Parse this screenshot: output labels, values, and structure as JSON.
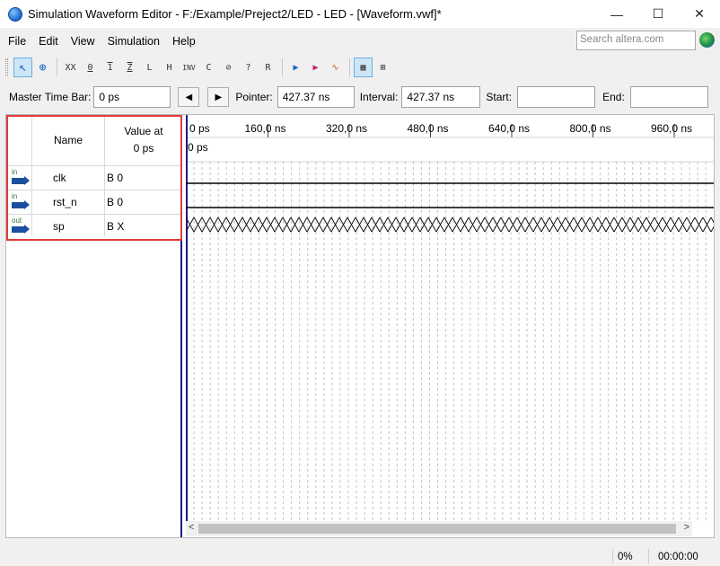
{
  "window": {
    "title": "Simulation Waveform Editor - F:/Example/Preject2/LED - LED - [Waveform.vwf]*",
    "minimize": "—",
    "maximize": "☐",
    "close": "✕"
  },
  "menu": {
    "items": [
      "File",
      "Edit",
      "View",
      "Simulation",
      "Help"
    ],
    "search_placeholder": "Search altera.com"
  },
  "toolbar": {
    "buttons": [
      {
        "icon": "pointer-icon",
        "glyph": "↖",
        "active": true
      },
      {
        "icon": "zoom-icon",
        "glyph": "🔍"
      },
      {
        "icon": "forcing-unknown-icon",
        "glyph": "XX"
      },
      {
        "icon": "forcing-low-icon",
        "glyph": "0"
      },
      {
        "icon": "forcing-high-icon",
        "glyph": "1"
      },
      {
        "icon": "forcing-z-icon",
        "glyph": "Z"
      },
      {
        "icon": "weak-low-icon",
        "glyph": "L"
      },
      {
        "icon": "weak-high-icon",
        "glyph": "H"
      },
      {
        "icon": "invert-icon",
        "glyph": "INV"
      },
      {
        "icon": "count-value-icon",
        "glyph": "C"
      },
      {
        "icon": "overwrite-clock-icon",
        "glyph": "⊘"
      },
      {
        "icon": "arbitrary-value-icon",
        "glyph": "?"
      },
      {
        "icon": "random-value-icon",
        "glyph": "R"
      },
      {
        "icon": "run-functional-sim-icon",
        "glyph": "▶"
      },
      {
        "icon": "run-timing-sim-icon",
        "glyph": "▶"
      },
      {
        "icon": "generate-netlist-icon",
        "glyph": "∿"
      },
      {
        "icon": "waveform-compare-icon",
        "glyph": "▦",
        "active": true
      },
      {
        "icon": "snap-grid-icon",
        "glyph": "⊞"
      }
    ]
  },
  "timebar": {
    "master_label": "Master Time Bar:",
    "master_value": "0 ps",
    "prev": "◀",
    "next": "▶",
    "pointer_label": "Pointer:",
    "pointer_value": "427.37 ns",
    "interval_label": "Interval:",
    "interval_value": "427.37 ns",
    "start_label": "Start:",
    "start_value": "",
    "end_label": "End:",
    "end_value": ""
  },
  "signal_table": {
    "col_name": "Name",
    "col_value_line1": "Value at",
    "col_value_line2": "0 ps",
    "signals": [
      {
        "dir": "in",
        "name": "clk",
        "value": "B 0",
        "wave": "low"
      },
      {
        "dir": "in",
        "name": "rst_n",
        "value": "B 0",
        "wave": "low"
      },
      {
        "dir": "out",
        "name": "sp",
        "value": "B X",
        "wave": "unknown"
      }
    ]
  },
  "timeline": {
    "ticks": [
      "0 ps",
      "160,0 ns",
      "320,0 ns",
      "480,0 ns",
      "640,0 ns",
      "800,0 ns",
      "960,0 ns"
    ],
    "cursor_label": "0 ps"
  },
  "status": {
    "progress": "0%",
    "elapsed": "00:00:00"
  }
}
